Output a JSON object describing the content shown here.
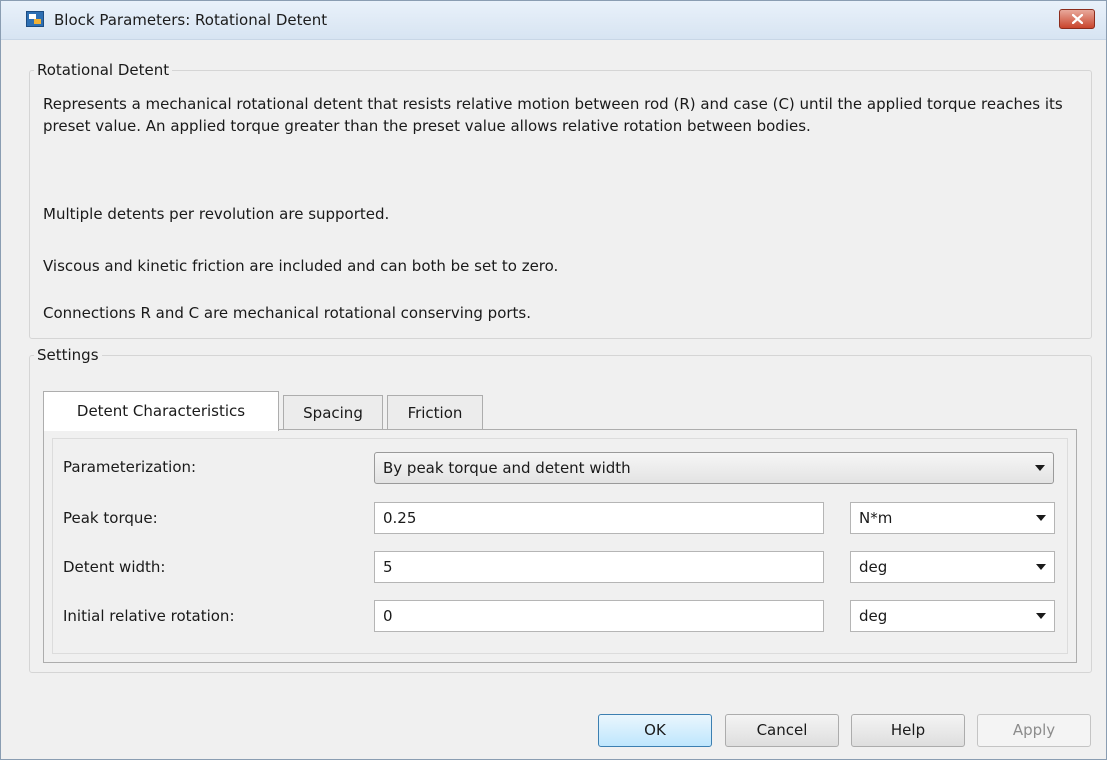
{
  "window": {
    "title": "Block Parameters: Rotational Detent"
  },
  "description_group": {
    "legend": "Rotational Detent",
    "paragraphs": [
      "Represents a mechanical rotational detent that resists relative motion between rod (R) and case (C) until the applied torque reaches its preset value. An applied torque greater than the preset value allows relative rotation between bodies.",
      "Multiple detents per revolution are supported.",
      "Viscous and kinetic friction are included and can both be set to zero.",
      "Connections R and C are mechanical rotational conserving ports."
    ]
  },
  "settings": {
    "legend": "Settings",
    "tabs": [
      {
        "label": "Detent Characteristics",
        "active": true
      },
      {
        "label": "Spacing",
        "active": false
      },
      {
        "label": "Friction",
        "active": false
      }
    ],
    "parameterization": {
      "label": "Parameterization:",
      "value": "By peak torque and detent width"
    },
    "params": [
      {
        "label": "Peak torque:",
        "value": "0.25",
        "unit": "N*m"
      },
      {
        "label": "Detent width:",
        "value": "5",
        "unit": "deg"
      },
      {
        "label": "Initial relative rotation:",
        "value": "0",
        "unit": "deg"
      }
    ]
  },
  "buttons": {
    "ok": "OK",
    "cancel": "Cancel",
    "help": "Help",
    "apply": "Apply"
  },
  "icons": {
    "app": "simulink-block-icon",
    "close": "close-icon",
    "dropdown": "chevron-down-icon"
  },
  "colors": {
    "close_button": "#c9452d",
    "ok_button_border": "#3c7fb1",
    "titlebar": "#dce7f3"
  }
}
